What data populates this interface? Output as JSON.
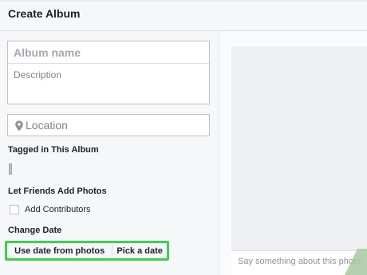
{
  "header": {
    "title": "Create Album"
  },
  "form": {
    "album_name_placeholder": "Album name",
    "description_placeholder": "Description",
    "location_placeholder": "Location",
    "tagged_label": "Tagged in This Album",
    "friends_label": "Let Friends Add Photos",
    "add_contributors_label": "Add Contributors",
    "add_contributors_checked": false,
    "change_date_label": "Change Date",
    "date_options": [
      "Use date from photos",
      "Pick a date"
    ]
  },
  "photo_panel": {
    "caption_placeholder": "Say something about this photo..."
  },
  "colors": {
    "highlight": "#3bd14d",
    "border": "#bec3c9",
    "panel": "#f6f7f9"
  },
  "icons": {
    "location": "map-pin-icon"
  }
}
